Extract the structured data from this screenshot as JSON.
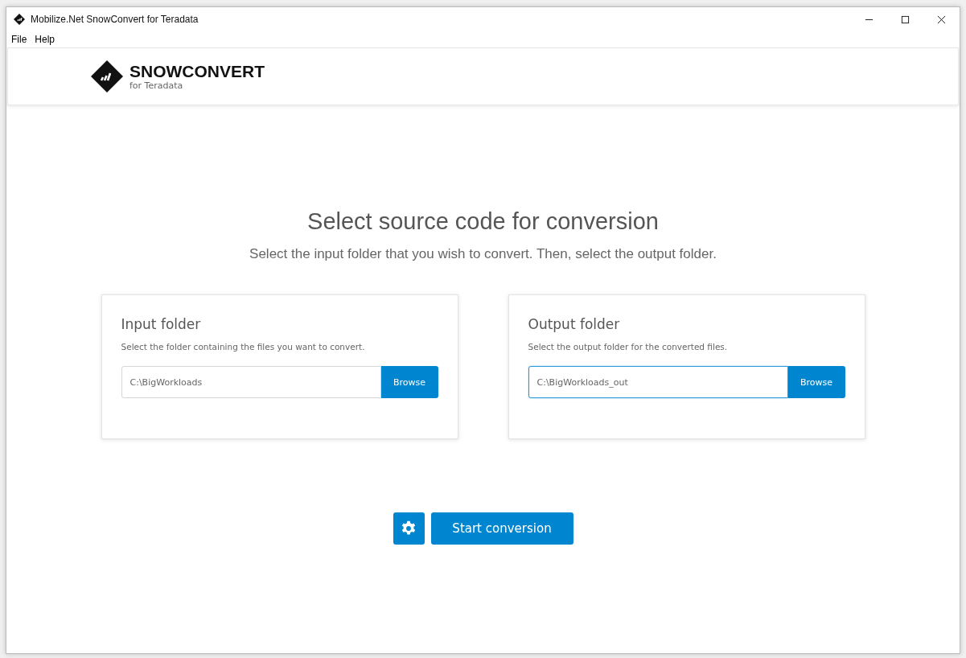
{
  "window": {
    "title": "Mobilize.Net SnowConvert for Teradata"
  },
  "menu": [
    "File",
    "Help"
  ],
  "logo": {
    "name": "SNOWCONVERT",
    "subtitle": "for Teradata"
  },
  "heading": "Select source code for conversion",
  "subheading": "Select the input folder that you wish to convert. Then, select the output folder.",
  "folders": [
    {
      "title": "Input folder",
      "description": "Select the folder containing the files you want to convert.",
      "value": "C:\\BigWorkloads",
      "button": "Browse",
      "focused": false
    },
    {
      "title": "Output folder",
      "description": "Select the output folder for the converted files.",
      "value": "C:\\BigWorkloads_out",
      "button": "Browse",
      "focused": true
    }
  ],
  "start_button": "Start conversion"
}
